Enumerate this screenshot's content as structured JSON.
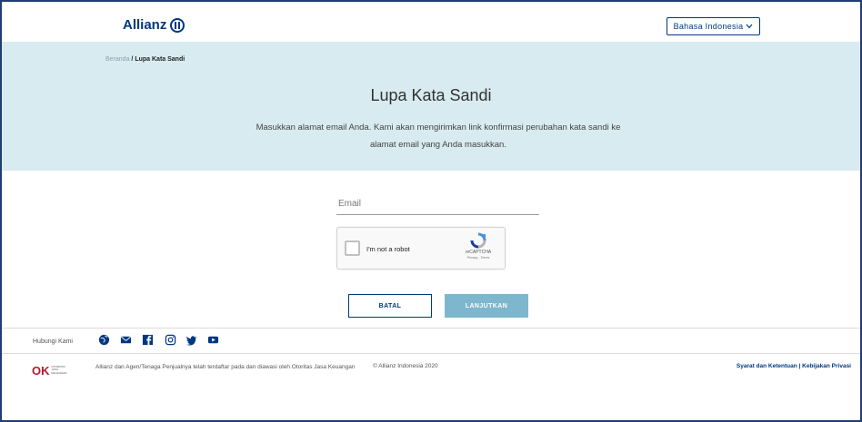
{
  "header": {
    "brand": "Allianz",
    "language": "Bahasa Indonesia"
  },
  "breadcrumb": {
    "home": "Beranda",
    "separator": "/",
    "current": "Lupa Kata Sandi"
  },
  "hero": {
    "title": "Lupa Kata Sandi",
    "description_line1": "Masukkan alamat email Anda. Kami akan mengirimkan link konfirmasi perubahan kata sandi ke",
    "description_line2": "alamat email yang Anda masukkan."
  },
  "form": {
    "email_label": "Email",
    "captcha_text": "I'm not a robot",
    "captcha_brand": "reCAPTCHA",
    "captcha_links": "Privacy - Terms",
    "cancel_label": "BATAL",
    "next_label": "LANJUTKAN"
  },
  "footer": {
    "contact_label": "Hubungi Kami",
    "social_icons": [
      "globe-icon",
      "mail-icon",
      "facebook-icon",
      "instagram-icon",
      "twitter-icon",
      "youtube-icon"
    ],
    "ojk_mark": "OK",
    "ojk_sub": "OTORITAS JASA KEUANGAN",
    "registration_text": "Allianz dan Agen/Tenaga Penjualnya telah terdaftar pada dan diawasi oleh Otoritas Jasa Keuangan",
    "copyright": "© Allianz Indonesia 2020",
    "terms_link": "Syarat dan Ketentuan",
    "legal_separator": "|",
    "privacy_link": "Kebijakan Privasi"
  },
  "colors": {
    "brand_blue": "#003781",
    "hero_bg": "#d8ebf0",
    "primary_button": "#7eb6cd",
    "ojk_red": "#b01c2e"
  }
}
